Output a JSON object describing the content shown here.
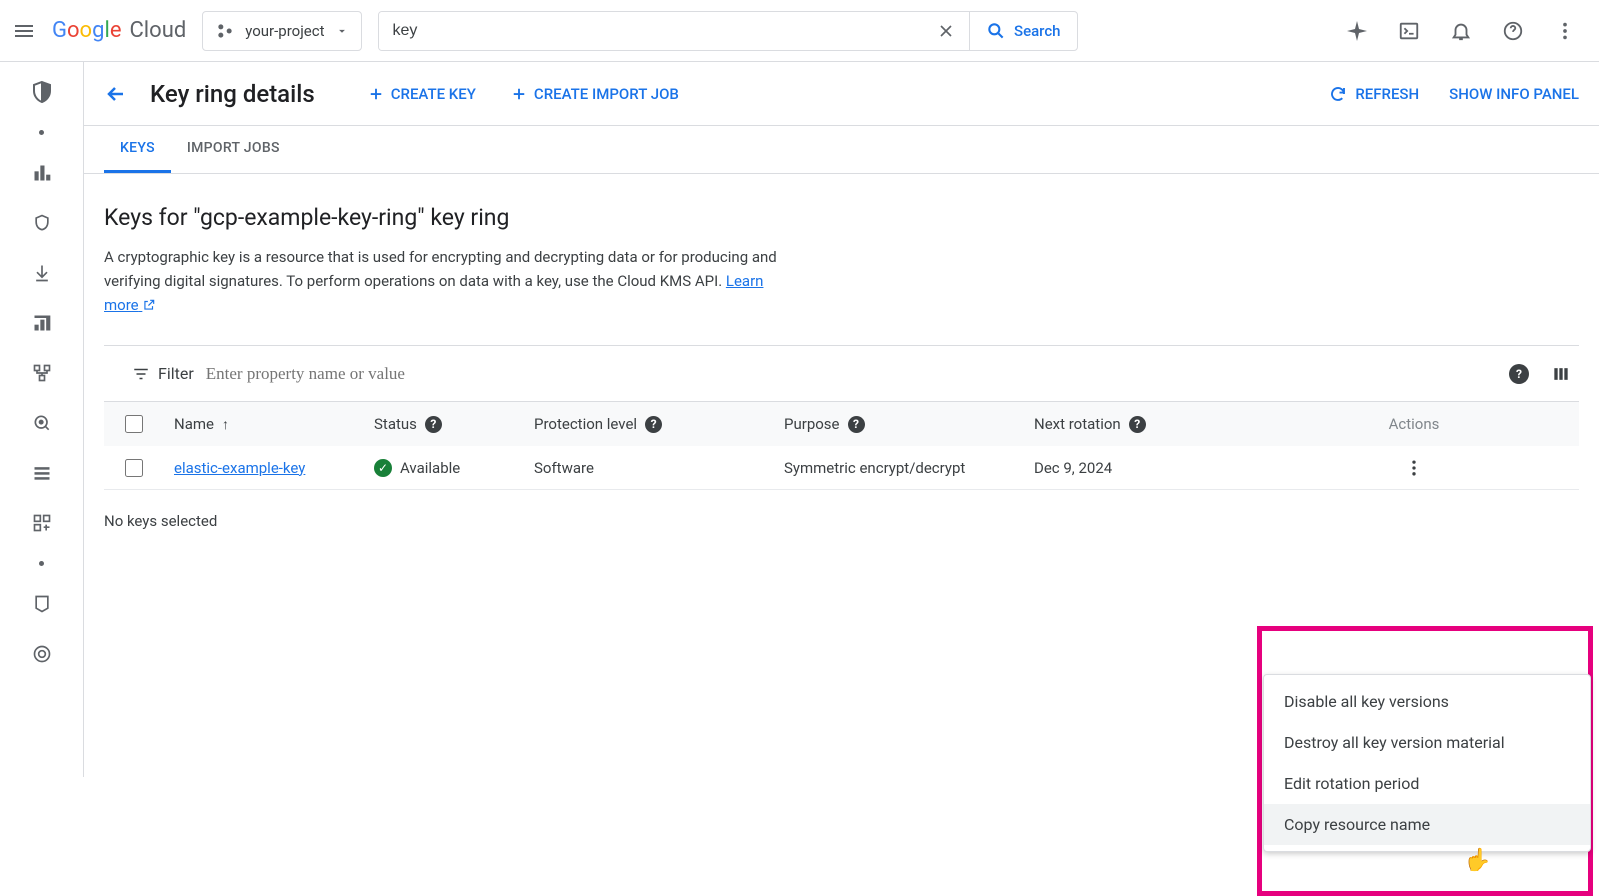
{
  "brand": {
    "word": "Google",
    "suffix": "Cloud"
  },
  "project": {
    "name": "your-project"
  },
  "search": {
    "value": "key",
    "button": "Search"
  },
  "page": {
    "title": "Key ring details",
    "create_key": "CREATE KEY",
    "create_import_job": "CREATE IMPORT JOB",
    "refresh": "REFRESH",
    "show_info": "SHOW INFO PANEL"
  },
  "tabs": {
    "keys": "KEYS",
    "import_jobs": "IMPORT JOBS"
  },
  "section": {
    "heading": "Keys for \"gcp-example-key-ring\" key ring",
    "desc_1": "A cryptographic key is a resource that is used for encrypting and decrypting data or for producing and verifying digital signatures. To perform operations on data with a key, use the Cloud KMS API. ",
    "learn_more": "Learn more"
  },
  "filter": {
    "label": "Filter",
    "placeholder": "Enter property name or value"
  },
  "table": {
    "headers": {
      "name": "Name",
      "status": "Status",
      "protection": "Protection level",
      "purpose": "Purpose",
      "next_rotation": "Next rotation",
      "actions": "Actions"
    },
    "rows": [
      {
        "name": "elastic-example-key",
        "status": "Available",
        "protection": "Software",
        "purpose": "Symmetric encrypt/decrypt",
        "next_rotation": "Dec 9, 2024"
      }
    ]
  },
  "footer_note": "No keys selected",
  "menu": {
    "items": [
      "Disable all key versions",
      "Destroy all key version material",
      "Edit rotation period",
      "Copy resource name"
    ]
  }
}
